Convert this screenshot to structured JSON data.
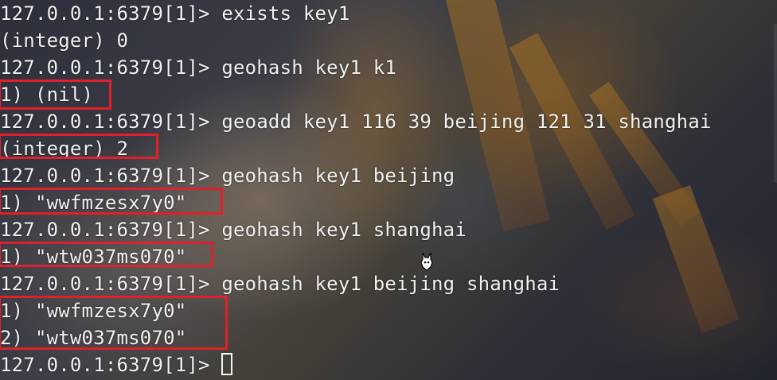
{
  "terminal": {
    "lines": [
      "127.0.0.1:6379[1]> exists key1",
      "(integer) 0",
      "127.0.0.1:6379[1]> geohash key1 k1",
      "1) (nil)",
      "127.0.0.1:6379[1]> geoadd key1 116 39 beijing 121 31 shanghai",
      "(integer) 2",
      "127.0.0.1:6379[1]> geohash key1 beijing",
      "1) \"wwfmzesx7y0\"",
      "127.0.0.1:6379[1]> geohash key1 shanghai",
      "1) \"wtw037ms070\"",
      "127.0.0.1:6379[1]> geohash key1 beijing shanghai",
      "1) \"wwfmzesx7y0\"",
      "2) \"wtw037ms070\"",
      "127.0.0.1:6379[1]> "
    ]
  },
  "colors": {
    "text": "#f2f2f2",
    "highlight_box": "#e0202a"
  },
  "icons": {
    "cursor": "block-cursor-icon",
    "pointer": "mouse-pointer-icon"
  }
}
